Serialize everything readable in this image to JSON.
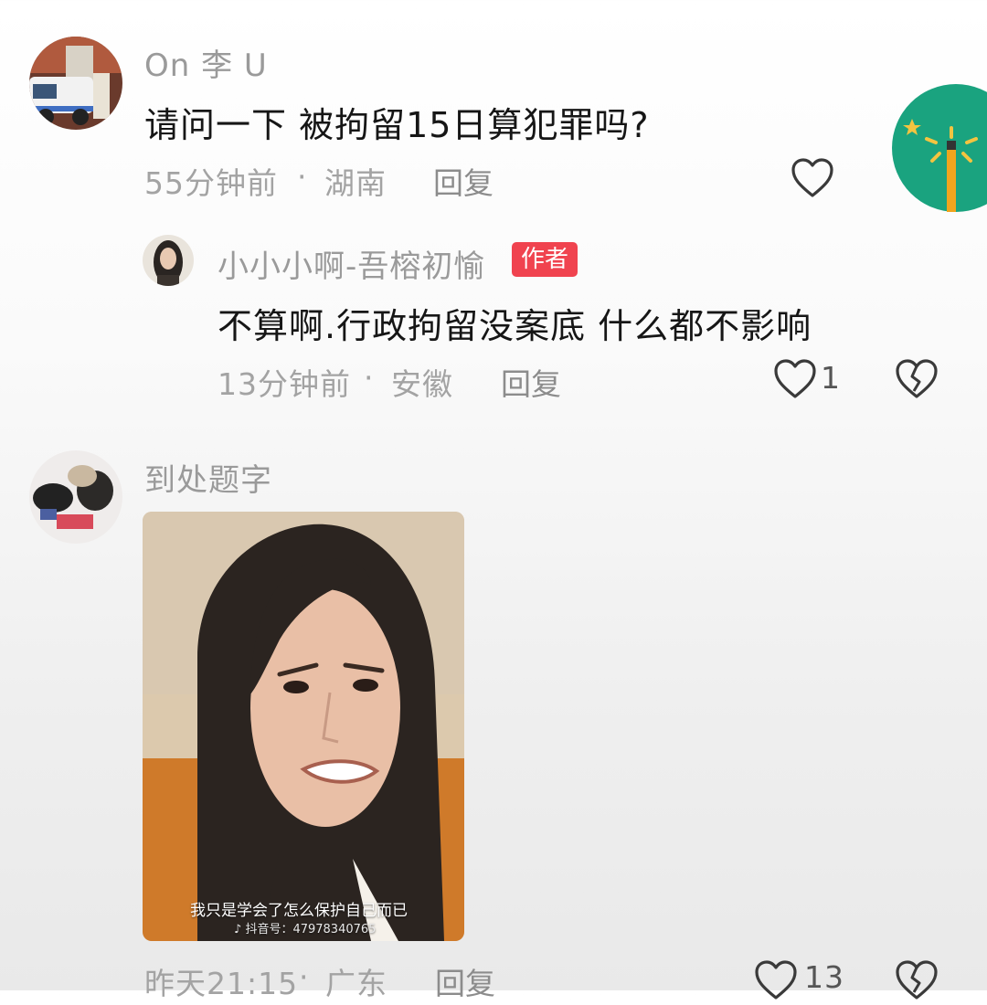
{
  "comments": [
    {
      "username": "On 李 U",
      "text": "请问一下 被拘留15日算犯罪吗?",
      "time": "55分钟前",
      "location": "湖南",
      "separator": "·",
      "reply_label": "回复",
      "like_icon": "heart-outline-icon"
    },
    {
      "username": "小小小啊-吾榕初愉",
      "badge": "作者",
      "text": "不算啊.行政拘留没案底 什么都不影响",
      "time": "13分钟前",
      "location": "安徽",
      "separator": "·",
      "reply_label": "回复",
      "like_count": "1",
      "like_icon": "heart-outline-icon",
      "dislike_icon": "broken-heart-icon"
    },
    {
      "username": "到处题字",
      "image_caption": "我只是学会了怎么保护自己而已",
      "image_watermark": "抖音号：47978340765",
      "time": "昨天21:15",
      "location": "广东",
      "separator": "·",
      "reply_label": "回复",
      "like_count": "13"
    }
  ],
  "floating": {
    "icon": "magic-wand-icon",
    "bg_color": "#1aa37f"
  },
  "colors": {
    "badge": "#f0434f",
    "meta": "#a3a3a3",
    "text": "#161616"
  }
}
